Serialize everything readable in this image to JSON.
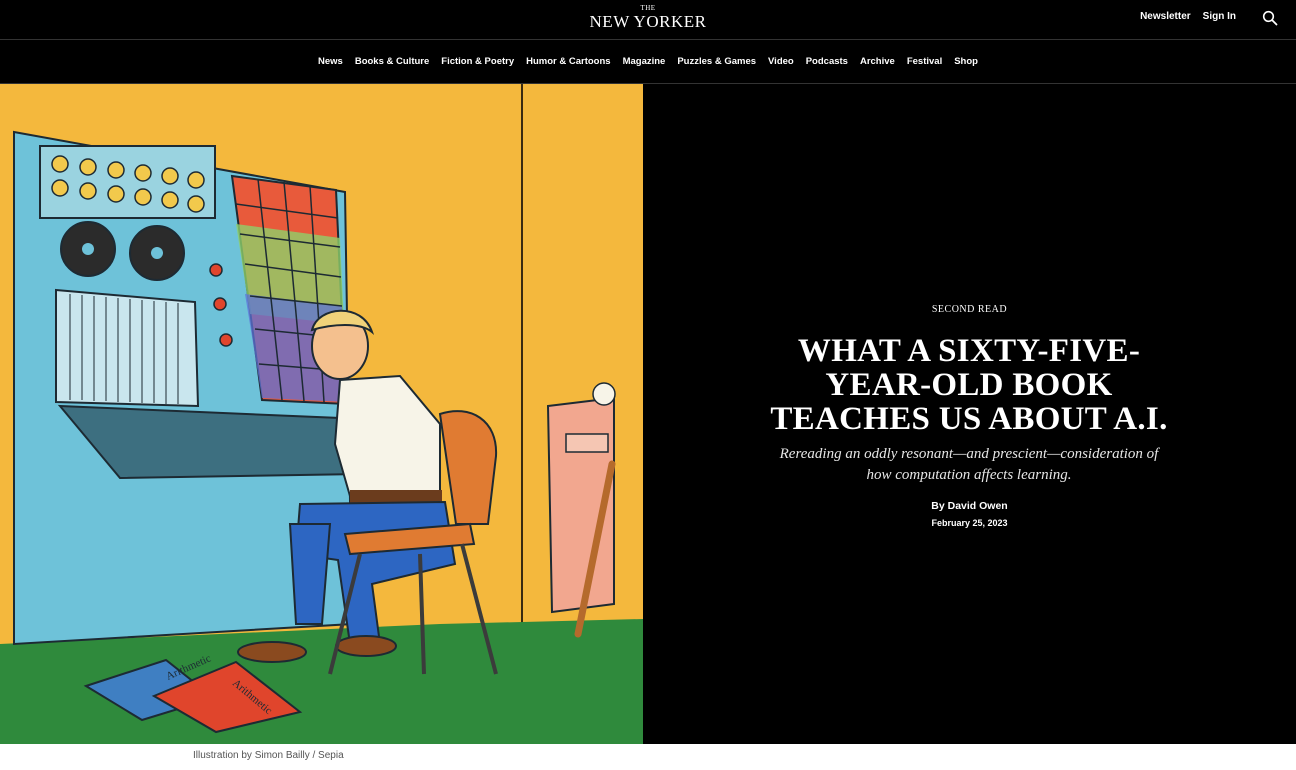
{
  "header": {
    "logo_the": "THE",
    "logo_name": "NEW YORKER",
    "newsletter": "Newsletter",
    "sign_in": "Sign In",
    "search_icon": "search-icon"
  },
  "nav": {
    "items": [
      "News",
      "Books & Culture",
      "Fiction & Poetry",
      "Humor & Cartoons",
      "Magazine",
      "Puzzles & Games",
      "Video",
      "Podcasts",
      "Archive",
      "Festival",
      "Shop"
    ]
  },
  "article": {
    "rubric": "Second Read",
    "headline": "What a Sixty-Five-Year-Old Book Teaches Us About A.I.",
    "dek": "Rereading an oddly resonant—and prescient—consideration of how computation affects learning.",
    "byline": "By David Owen",
    "date": "February 25, 2023"
  },
  "illustration": {
    "book1_title": "Arithmetic",
    "book2_title": "Arithmetic",
    "caption": "Illustration by Simon Bailly / Sepia"
  },
  "colors": {
    "background": "#000000",
    "wall": "#f4b83d",
    "floor": "#2f8a3c",
    "machine": "#6ec2d9",
    "accent_red": "#e0452c"
  }
}
